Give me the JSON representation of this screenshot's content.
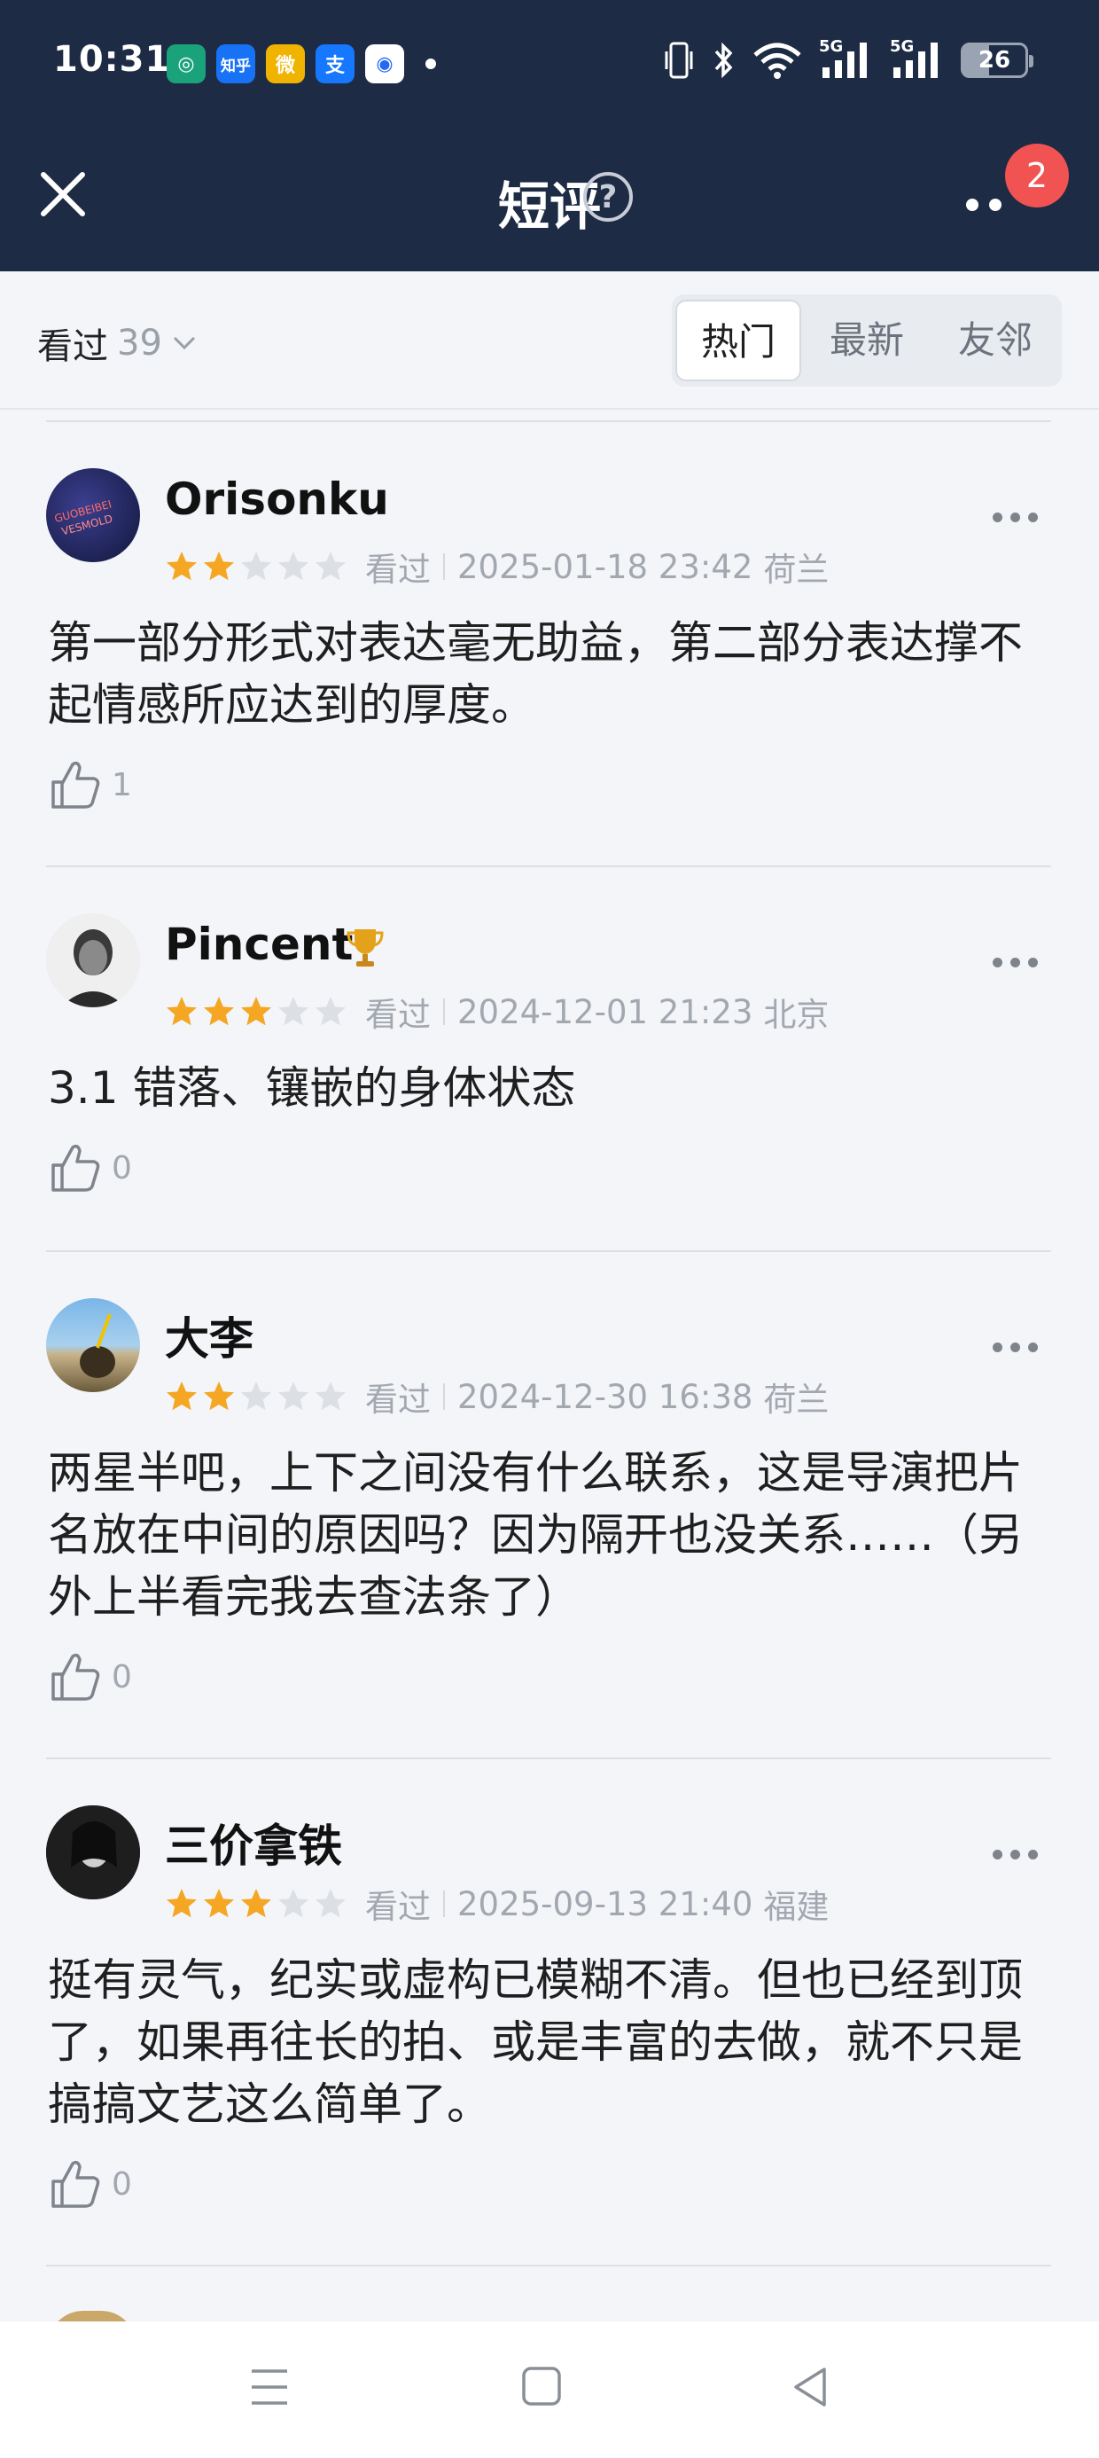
{
  "status_bar": {
    "time": "10:31",
    "apps": [
      {
        "icon": "chatgpt-icon",
        "color": "#1aa37a",
        "text": "◎"
      },
      {
        "icon": "zhihu-icon",
        "color": "#1772f6",
        "text": "知乎"
      },
      {
        "icon": "weibo-icon",
        "color": "#f0b400",
        "text": "微"
      },
      {
        "icon": "alipay-icon",
        "color": "#1677ff",
        "text": "支"
      },
      {
        "icon": "baidu-icon",
        "color": "#ffffff",
        "text": "◉"
      }
    ],
    "network1": "5G",
    "network2": "5G",
    "battery": "26"
  },
  "header": {
    "title": "短评",
    "help": "?",
    "badge": "2"
  },
  "filter": {
    "seen_label": "看过",
    "seen_count": "39",
    "tabs": [
      "热门",
      "最新",
      "友邻"
    ],
    "active_tab": 0
  },
  "comments": [
    {
      "user": "Orisonku",
      "rating": 2,
      "status": "看过",
      "datetime": "2025-01-18 23:42",
      "location": "荷兰",
      "text": "第一部分形式对表达毫无助益，第二部分表达撑不起情感所应达到的厚度。",
      "likes": "1",
      "avatar_color": "#1a1f45"
    },
    {
      "user": "Pincent",
      "rating": 3,
      "status": "看过",
      "datetime": "2024-12-01 21:23",
      "location": "北京",
      "text": "3.1 错落、镶嵌的身体状态",
      "likes": "0",
      "avatar_color": "#d8d8d8",
      "has_trophy": true
    },
    {
      "user": "大李",
      "rating": 2,
      "status": "看过",
      "datetime": "2024-12-30 16:38",
      "location": "荷兰",
      "text": "两星半吧，上下之间没有什么联系，这是导演把片名放在中间的原因吗？因为隔开也没关系……（另外上半看完我去查法条了）",
      "likes": "0",
      "avatar_color": "#6fa6d6"
    },
    {
      "user": "三价拿铁",
      "rating": 3,
      "status": "看过",
      "datetime": "2025-09-13 21:40",
      "location": "福建",
      "text": "挺有灵气，纪实或虚构已模糊不清。但也已经到顶了，如果再往长的拍、或是丰富的去做，就不只是搞搞文艺这么简单了。",
      "likes": "0",
      "avatar_color": "#2a2a2a"
    }
  ],
  "colors": {
    "header_bg": "#1d2b44",
    "star_on": "#f5a623",
    "star_off": "#dcdfe4",
    "badge": "#f15353"
  }
}
